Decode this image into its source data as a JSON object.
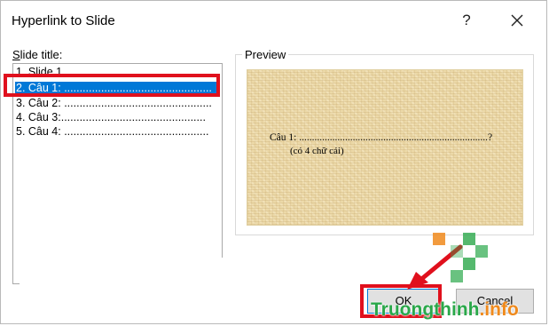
{
  "dialog": {
    "title": "Hyperlink to Slide",
    "help_label": "?"
  },
  "slide_list": {
    "label_accesskey": "S",
    "label_rest": "lide title:",
    "items": [
      {
        "label": "1. Slide 1",
        "selected": false
      },
      {
        "label": "2. Câu 1: ................................................",
        "selected": true
      },
      {
        "label": "3. Câu 2: ................................................",
        "selected": false
      },
      {
        "label": "4. Câu 3:...............................................",
        "selected": false
      },
      {
        "label": "5. Câu 4: ...............................................",
        "selected": false
      }
    ]
  },
  "preview": {
    "caption": "Preview",
    "line1": "Câu 1: ..........................................................................?",
    "line2": "(có 4 chữ cái)"
  },
  "buttons": {
    "ok_label": "OK",
    "cancel_label": "Cancel"
  },
  "annotations": {
    "highlight_color": "#e0101d"
  },
  "watermark": {
    "main": "Truongthinh",
    "sub": ".info"
  },
  "colors": {
    "selection": "#0078d7",
    "accent_green": "#2aa84a",
    "accent_orange": "#f08a1c"
  }
}
